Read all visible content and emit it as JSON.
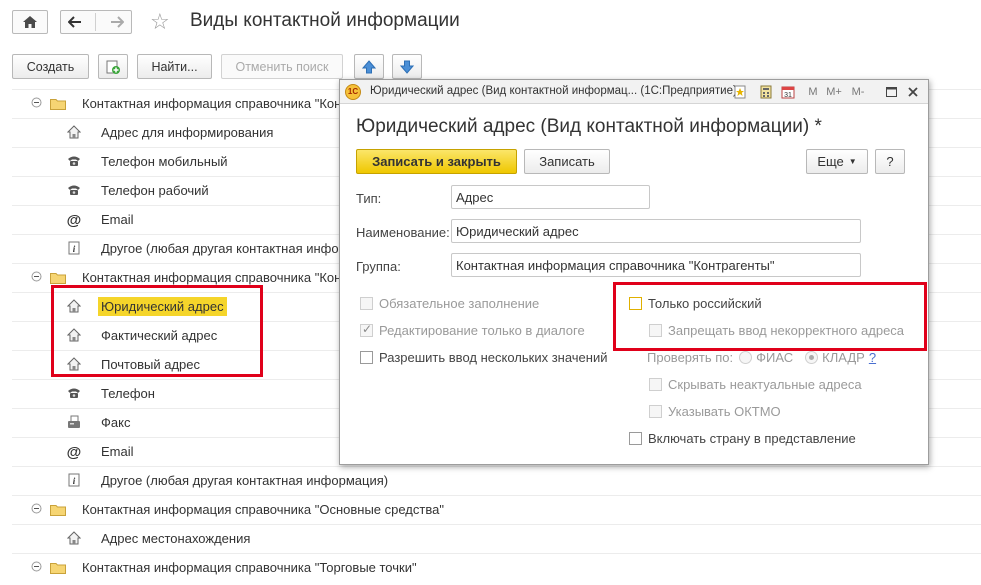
{
  "window": {
    "title": "Виды контактной информации"
  },
  "toolbar": {
    "create": "Создать",
    "find": "Найти...",
    "cancel_search": "Отменить поиск"
  },
  "list": {
    "rows": [
      {
        "label": "Контактная информация справочника \"Конт",
        "type": "group"
      },
      {
        "label": "Адрес для информирования",
        "icon": "house-icon"
      },
      {
        "label": "Телефон мобильный",
        "icon": "phone-icon"
      },
      {
        "label": "Телефон рабочий",
        "icon": "phone-icon"
      },
      {
        "label": "Email",
        "icon": "at-icon"
      },
      {
        "label": "Другое (любая другая контактная инфор",
        "icon": "info-icon"
      },
      {
        "label": "Контактная информация справочника \"Конт",
        "type": "group"
      },
      {
        "label": "Юридический адрес",
        "icon": "house-icon",
        "selected": true
      },
      {
        "label": "Фактический адрес",
        "icon": "house-icon"
      },
      {
        "label": "Почтовый адрес",
        "icon": "house-icon"
      },
      {
        "label": "Телефон",
        "icon": "phone-icon"
      },
      {
        "label": "Факс",
        "icon": "fax-icon"
      },
      {
        "label": "Email",
        "icon": "at-icon"
      },
      {
        "label": "Другое (любая другая контактная информация)",
        "icon": "info-icon"
      },
      {
        "label": "Контактная информация справочника \"Основные средства\"",
        "type": "group"
      },
      {
        "label": "Адрес местонахождения",
        "icon": "house-icon"
      },
      {
        "label": "Контактная информация справочника \"Торговые точки\"",
        "type": "group"
      }
    ]
  },
  "dialog": {
    "caption": "Юридический адрес (Вид контактной информац...  (1С:Предприятие)",
    "heading": "Юридический адрес (Вид контактной информации) *",
    "buttons": {
      "save_close": "Записать и закрыть",
      "save": "Записать",
      "more": "Еще",
      "help": "?"
    },
    "memory_buttons": [
      "M",
      "M+",
      "M-"
    ],
    "fields": {
      "type_label": "Тип:",
      "type_value": "Адрес",
      "name_label": "Наименование:",
      "name_value": "Юридический адрес",
      "group_label": "Группа:",
      "group_value": "Контактная информация справочника \"Контрагенты\""
    },
    "options": {
      "mandatory": "Обязательное заполнение",
      "dialog_only": "Редактирование только в диалоге",
      "multiple": "Разрешить ввод нескольких значений",
      "russian_only": "Только российский",
      "forbid_incorrect": "Запрещать ввод некорректного адреса",
      "check_by": "Проверять по:",
      "fias": "ФИАС",
      "kladr": "КЛАДР",
      "check_help": "?",
      "hide_obsolete": "Скрывать неактуальные адреса",
      "show_oktmo": "Указывать ОКТМО",
      "include_country": "Включать страну в представление"
    },
    "checked": {
      "mandatory": false,
      "dialog_only": true,
      "multiple": false,
      "russian_only": false
    }
  },
  "colors": {
    "highlight": "#e0001a",
    "selection": "#f5d52a",
    "primary_button": "#f1cc10"
  }
}
